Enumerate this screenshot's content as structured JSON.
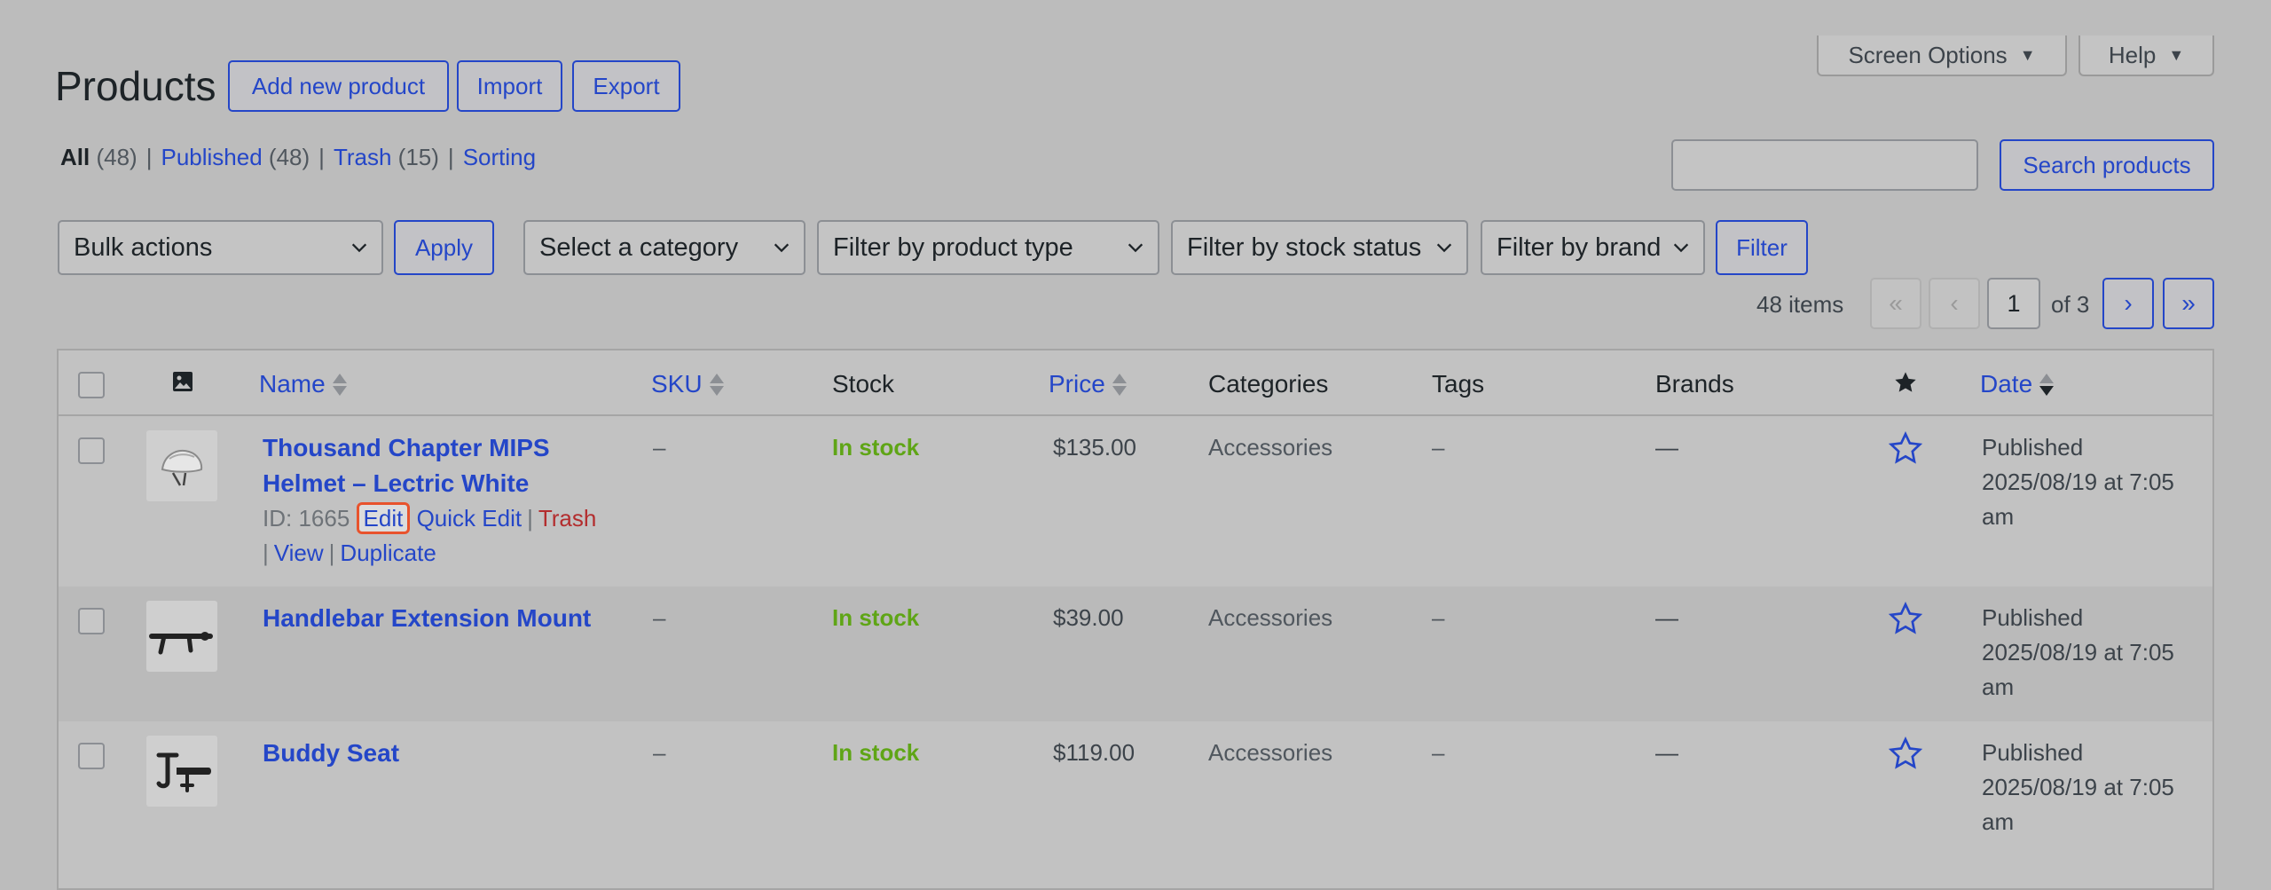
{
  "header": {
    "title": "Products",
    "add_new": "Add new product",
    "import": "Import",
    "export": "Export",
    "screen_options": "Screen Options",
    "help": "Help"
  },
  "views": [
    {
      "label": "All",
      "count": "(48)"
    },
    {
      "label": "Published",
      "count": "(48)"
    },
    {
      "label": "Trash",
      "count": "(15)"
    },
    {
      "label": "Sorting",
      "count": ""
    }
  ],
  "search": {
    "value": "",
    "button": "Search products"
  },
  "filters": {
    "bulk_actions": "Bulk actions",
    "apply": "Apply",
    "category": "Select a category",
    "product_type": "Filter by product type",
    "stock_status": "Filter by stock status",
    "brand": "Filter by brand",
    "filter": "Filter"
  },
  "pagination": {
    "items": "48 items",
    "first": "«",
    "prev": "‹",
    "current": "1",
    "of": "of 3",
    "next": "›",
    "last": "»"
  },
  "columns": {
    "name": "Name",
    "sku": "SKU",
    "stock": "Stock",
    "price": "Price",
    "categories": "Categories",
    "tags": "Tags",
    "brands": "Brands",
    "date": "Date"
  },
  "rows": [
    {
      "name_line1": "Thousand Chapter MIPS",
      "name_line2": "Helmet – Lectric White",
      "id": "ID: 1665",
      "actions": {
        "edit": "Edit",
        "quick_edit": "Quick Edit",
        "trash": "Trash",
        "view": "View",
        "duplicate": "Duplicate"
      },
      "sku": "–",
      "stock": "In stock",
      "price": "$135.00",
      "category": "Accessories",
      "tags": "–",
      "brands": "—",
      "date_status": "Published",
      "date_line": "2025/08/19 at 7:05",
      "date_tail": "am"
    },
    {
      "name_line1": "Handlebar Extension Mount",
      "sku": "–",
      "stock": "In stock",
      "price": "$39.00",
      "category": "Accessories",
      "tags": "–",
      "brands": "—",
      "date_status": "Published",
      "date_line": "2025/08/19 at 7:05",
      "date_tail": "am"
    },
    {
      "name_line1": "Buddy Seat",
      "sku": "–",
      "stock": "In stock",
      "price": "$119.00",
      "category": "Accessories",
      "tags": "–",
      "brands": "—",
      "date_status": "Published",
      "date_line": "2025/08/19 at 7:05",
      "date_tail": "am"
    }
  ],
  "colors": {
    "link": "#2446c8",
    "in_stock": "#5fa516",
    "trash": "#b32d2e",
    "highlight": "#e8532d"
  }
}
